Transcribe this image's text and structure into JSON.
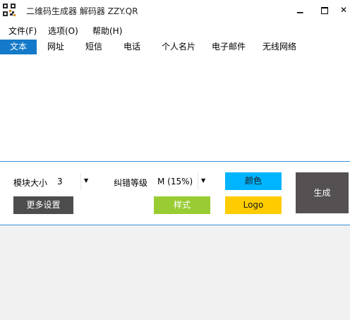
{
  "window": {
    "title": "二维码生成器 解码器 ZZY.QR",
    "minimize_glyph": "▁",
    "close_glyph": "✕"
  },
  "menu": [
    "文件(F)",
    "选项(O)",
    "帮助(H)"
  ],
  "tabs": [
    "文本",
    "网址",
    "短信",
    "电话",
    "个人名片",
    "电子邮件",
    "无线网络"
  ],
  "active_tab": "文本",
  "text_input": {
    "value": ""
  },
  "settings": {
    "module_size_label": "模块大小",
    "module_size_value": "3",
    "error_level_label": "纠错等级",
    "error_level_value": "M (15%)",
    "more_settings_label": "更多设置",
    "style_label": "样式",
    "color_label": "颜色",
    "logo_label": "Logo",
    "generate_label": "生成",
    "dropdown_arrow": "▼"
  },
  "colors": {
    "tab_active_bg": "#1479c8",
    "separator": "#3c8fd6",
    "style_button": "#99cc33",
    "color_button": "#00b4ff",
    "logo_button": "#ffcc00",
    "generate_button": "#555152",
    "more_settings_button": "#4d4d4d",
    "bottom_area": "#f1f1f1"
  }
}
